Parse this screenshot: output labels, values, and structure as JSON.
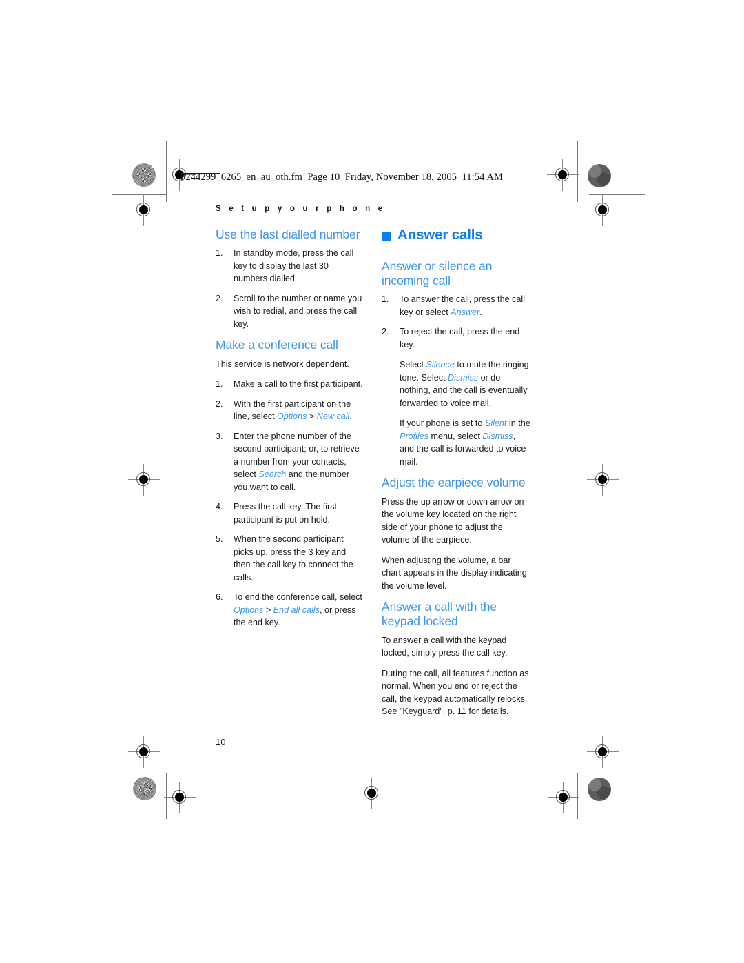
{
  "print_marks": {
    "file_stamp": "9244299_6265_en_au_oth.fm  Page 10  Friday, November 18, 2005  11:54 AM",
    "registration_icon": "registration-target-icon",
    "halftone_icon": "halftone-density-patch-icon"
  },
  "running_head": "S e t   u p   y o u r   p h o n e",
  "page_number": "10",
  "colors": {
    "chapter_heading": "#0c7cf0",
    "section_heading": "#3d95ee",
    "ui_term": "#3d95ee",
    "body_text": "#1b1b1b"
  },
  "left_column": {
    "section_1": {
      "heading": "Use the last dialled number",
      "steps": [
        "In standby mode, press the call key to display the last 30 numbers dialled.",
        "Scroll to the number or name you wish to redial, and press the call key."
      ]
    },
    "section_2": {
      "heading": "Make a conference call",
      "intro": "This service is network dependent.",
      "steps": [
        {
          "parts": [
            {
              "t": "Make a call to the first participant."
            }
          ]
        },
        {
          "parts": [
            {
              "t": "With the first participant on the line, select "
            },
            {
              "t": "Options",
              "ui": true
            },
            {
              "t": " > ",
              "gt": true
            },
            {
              "t": "New call",
              "ui": true
            },
            {
              "t": "."
            }
          ]
        },
        {
          "parts": [
            {
              "t": "Enter the phone number of the second participant; or, to retrieve a number from your contacts, select "
            },
            {
              "t": "Search",
              "ui": true
            },
            {
              "t": " and the number you want to call."
            }
          ]
        },
        {
          "parts": [
            {
              "t": "Press the call key. The first participant is put on hold."
            }
          ]
        },
        {
          "parts": [
            {
              "t": "When the second participant picks up, press the 3 key and then the call key to connect the calls."
            }
          ]
        },
        {
          "parts": [
            {
              "t": "To end the conference call, select "
            },
            {
              "t": "Options",
              "ui": true
            },
            {
              "t": " > ",
              "gt": true
            },
            {
              "t": "End all calls",
              "ui": true
            },
            {
              "t": ", or press the end key."
            }
          ]
        }
      ]
    }
  },
  "right_column": {
    "chapter_heading": "Answer calls",
    "section_1": {
      "heading": "Answer or silence an incoming call",
      "steps": [
        {
          "parts": [
            {
              "t": "To answer the call, press the call key or select "
            },
            {
              "t": "Answer",
              "ui": true
            },
            {
              "t": "."
            }
          ]
        },
        {
          "parts": [
            {
              "t": "To reject the call, press the end key."
            }
          ]
        }
      ],
      "paragraphs": [
        {
          "parts": [
            {
              "t": "Select "
            },
            {
              "t": "Silence",
              "ui": true
            },
            {
              "t": " to mute the ringing tone. Select "
            },
            {
              "t": "Dismiss",
              "ui": true
            },
            {
              "t": " or do nothing, and the call is eventually forwarded to voice mail."
            }
          ]
        },
        {
          "parts": [
            {
              "t": "If your phone is set to "
            },
            {
              "t": "Silent",
              "ui": true
            },
            {
              "t": " in the "
            },
            {
              "t": "Profiles",
              "ui": true
            },
            {
              "t": " menu, select "
            },
            {
              "t": "Dismiss",
              "ui": true
            },
            {
              "t": ", and the call is forwarded to voice mail."
            }
          ]
        }
      ]
    },
    "section_2": {
      "heading": "Adjust the earpiece volume",
      "paragraphs": [
        "Press the up arrow or down arrow on the volume key located on the right side of your phone to adjust the volume of the earpiece.",
        "When adjusting the volume, a bar chart appears in the display indicating the volume level."
      ]
    },
    "section_3": {
      "heading": "Answer a call with the keypad locked",
      "paragraphs": [
        "To answer a call with the keypad locked, simply press the call key.",
        "During the call, all features function as normal. When you end or reject the call, the keypad automatically relocks. See \"Keyguard\", p. 11 for details."
      ]
    }
  }
}
